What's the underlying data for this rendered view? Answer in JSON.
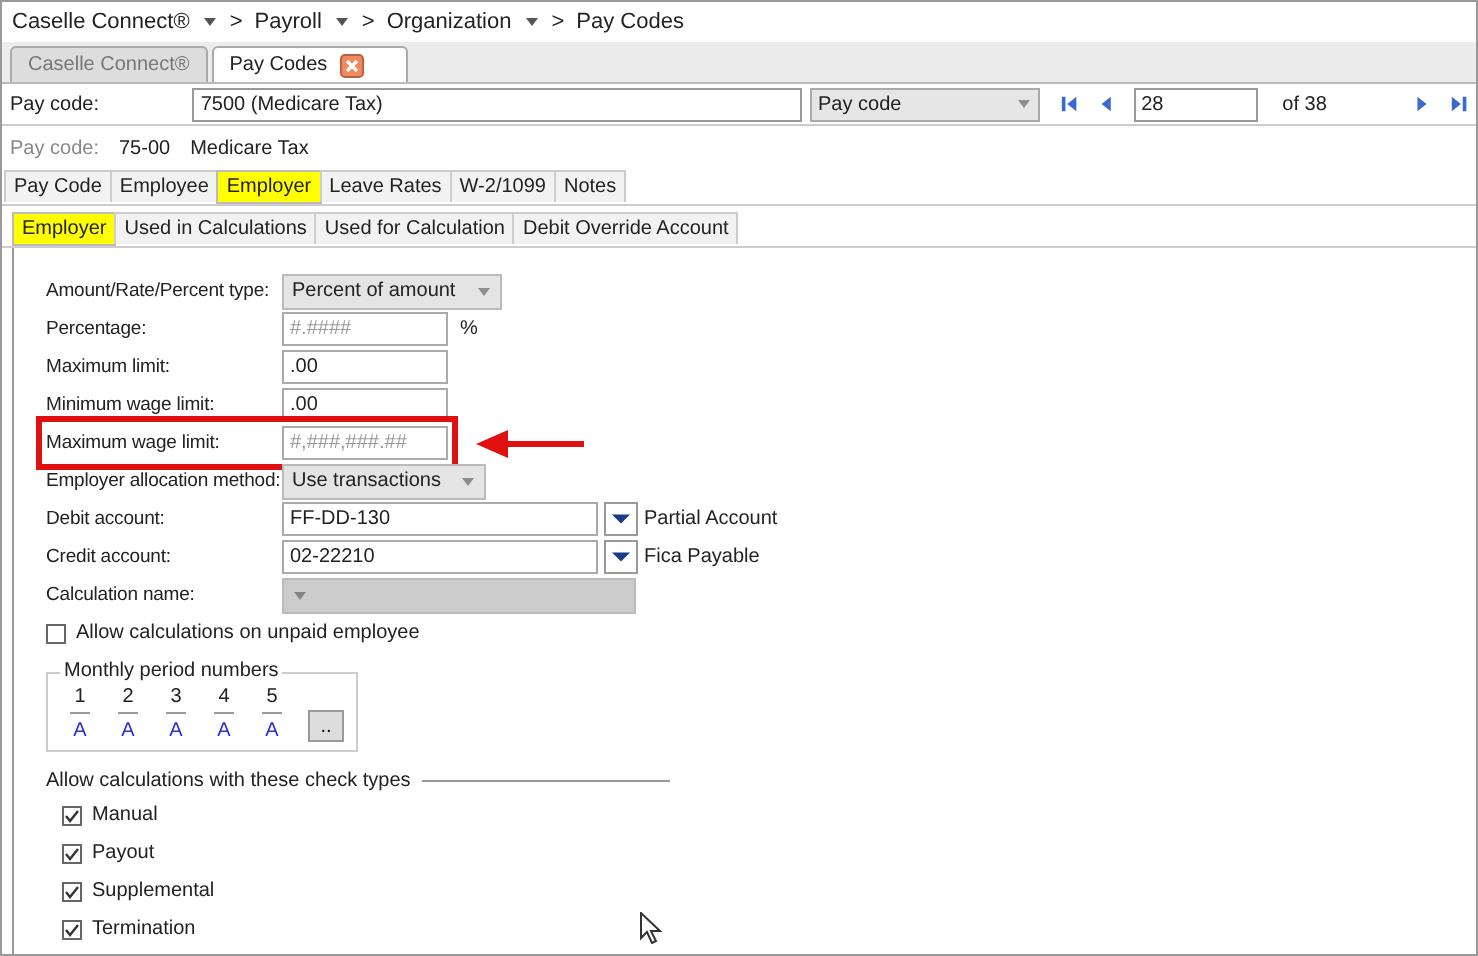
{
  "breadcrumb": {
    "separator": ">",
    "items": [
      {
        "label": "Caselle Connect®"
      },
      {
        "label": "Payroll"
      },
      {
        "label": "Organization"
      },
      {
        "label": "Pay Codes"
      }
    ]
  },
  "doc_tabs": [
    {
      "label": "Caselle Connect®",
      "selected": false,
      "closable": false
    },
    {
      "label": "Pay Codes",
      "selected": true,
      "closable": true
    }
  ],
  "lookup": {
    "label": "Pay code:",
    "value": "7500 (Medicare Tax)",
    "search_by": "Pay code",
    "record": "28",
    "of": "of 38"
  },
  "info": {
    "label": "Pay code:",
    "code": "75-00",
    "name": "Medicare Tax"
  },
  "tabs": [
    {
      "label": "Pay Code",
      "selected": false
    },
    {
      "label": "Employee",
      "selected": false
    },
    {
      "label": "Employer",
      "selected": true
    },
    {
      "label": "Leave Rates",
      "selected": false
    },
    {
      "label": "W-2/1099",
      "selected": false
    },
    {
      "label": "Notes",
      "selected": false
    }
  ],
  "subtabs": [
    {
      "label": "Employer",
      "selected": true
    },
    {
      "label": "Used in Calculations",
      "selected": false
    },
    {
      "label": "Used for Calculation",
      "selected": false
    },
    {
      "label": "Debit Override Account",
      "selected": false
    }
  ],
  "fields": [
    {
      "kind": "select",
      "label": "Amount/Rate/Percent type:",
      "value": "Percent of amount",
      "disabled": false,
      "callout": false
    },
    {
      "kind": "input",
      "label": "Percentage:",
      "placeholder": "#.####",
      "unit": "%",
      "disabled": false,
      "callout": false
    },
    {
      "kind": "input",
      "label": "Maximum limit:",
      "value": ".00",
      "disabled": false,
      "callout": false
    },
    {
      "kind": "input",
      "label": "Minimum wage limit:",
      "value": ".00",
      "disabled": false,
      "callout": false
    },
    {
      "kind": "input",
      "label": "Maximum wage limit:",
      "placeholder": "#,###,###.##",
      "disabled": false,
      "callout": true
    },
    {
      "kind": "select",
      "label": "Employer allocation method:",
      "value": "Use transactions",
      "disabled": false,
      "callout": false
    },
    {
      "kind": "account",
      "label": "Debit account:",
      "value": "FF-DD-130",
      "description": "Partial Account",
      "disabled": false,
      "callout": false
    },
    {
      "kind": "account",
      "label": "Credit account:",
      "value": "02-22210",
      "description": "Fica Payable",
      "disabled": false,
      "callout": false
    },
    {
      "kind": "select",
      "label": "Calculation name:",
      "disabled": true,
      "callout": false
    }
  ],
  "unpaid": {
    "label": "Allow calculations on unpaid employee",
    "checked": false
  },
  "periods": {
    "title": "Monthly period numbers",
    "columns": [
      {
        "number": "1",
        "value": "A"
      },
      {
        "number": "2",
        "value": "A"
      },
      {
        "number": "3",
        "value": "A"
      },
      {
        "number": "4",
        "value": "A"
      },
      {
        "number": "5",
        "value": "A"
      }
    ],
    "more": ".."
  },
  "check_types": {
    "title": "Allow calculations with these check types",
    "items": [
      {
        "label": "Manual",
        "checked": true
      },
      {
        "label": "Payout",
        "checked": true
      },
      {
        "label": "Supplemental",
        "checked": true
      },
      {
        "label": "Termination",
        "checked": true
      }
    ]
  }
}
